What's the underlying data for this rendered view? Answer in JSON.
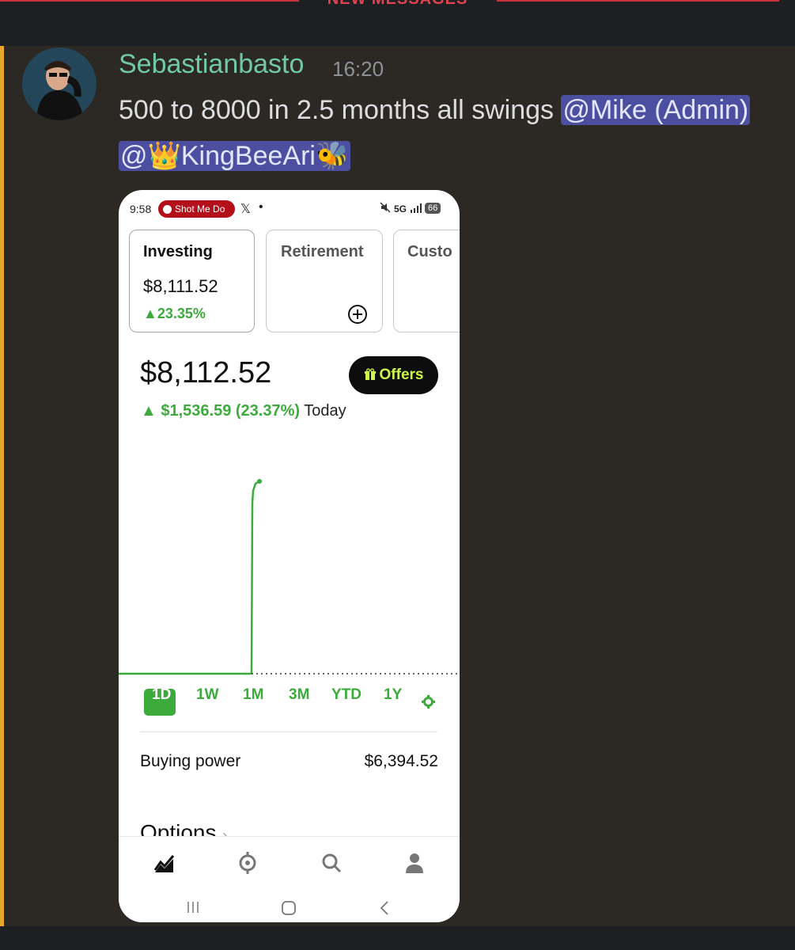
{
  "banner": {
    "new_messages": "NEW MESSAGES"
  },
  "message": {
    "username": "Sebastianbasto",
    "time": "16:20",
    "text": "500 to 8000 in 2.5 months all swings",
    "mention_1": "@Mike (Admin)",
    "mention_2": "@👑KingBeeAri🐝"
  },
  "phone": {
    "status": {
      "time": "9:58",
      "notif_pill": "Shot Me Do",
      "x_icon": "𝕏",
      "dot": "•",
      "signal": "5G",
      "battery": "66"
    },
    "account_cards": [
      {
        "title": "Investing",
        "value": "$8,111.52",
        "change": "▲23.35%"
      },
      {
        "title": "Retirement"
      },
      {
        "title": "Custo"
      }
    ],
    "portfolio_value": "$8,112.52",
    "offers_label": "Offers",
    "change_line": "▲ $1,536.59 (23.37%)",
    "change_suffix": "Today",
    "ranges": [
      "1D",
      "1W",
      "1M",
      "3M",
      "YTD",
      "1Y"
    ],
    "selected_range": "1D",
    "buying_power_label": "Buying power",
    "buying_power_value": "$6,394.52",
    "options_label": "Options",
    "colors": {
      "accent_green": "#3cab3c",
      "offers_text": "#cff54b",
      "mention_bg": "#4c4f9f"
    }
  }
}
